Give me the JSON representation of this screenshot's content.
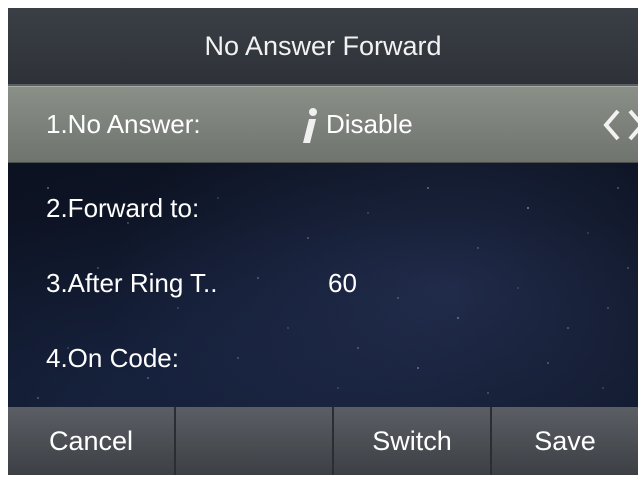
{
  "header": {
    "title": "No Answer Forward"
  },
  "rows": [
    {
      "label": "1.No Answer:",
      "value": "Disable",
      "icon": "info-icon"
    },
    {
      "label": "2.Forward to:",
      "value": ""
    },
    {
      "label": "3.After Ring T..",
      "value": "60"
    },
    {
      "label": "4.On Code:",
      "value": ""
    }
  ],
  "softkeys": [
    {
      "label": "Cancel"
    },
    {
      "label": ""
    },
    {
      "label": "Switch"
    },
    {
      "label": "Save"
    }
  ],
  "colors": {
    "titlebar": "#33373d",
    "selected_row": "#7c817b",
    "softkey": "#4a4e54",
    "text": "#ffffff",
    "background": "#0b1120"
  }
}
